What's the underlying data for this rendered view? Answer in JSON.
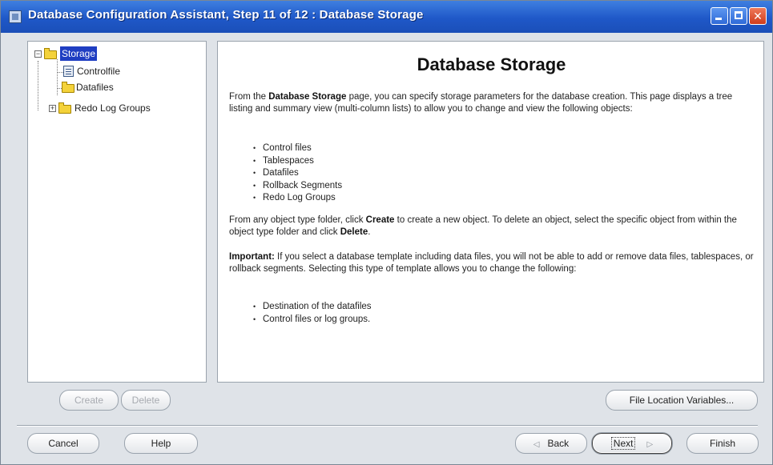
{
  "window": {
    "title": "Database Configuration Assistant, Step 11 of 12 : Database Storage"
  },
  "tree": {
    "root": {
      "label": "Storage",
      "expander": "−"
    },
    "items": [
      {
        "label": "Controlfile",
        "icon": "file-icon"
      },
      {
        "label": "Datafiles",
        "icon": "folder-icon"
      },
      {
        "label": "Redo Log Groups",
        "icon": "folder-icon",
        "expander": "+"
      }
    ]
  },
  "content": {
    "heading": "Database Storage",
    "intro": {
      "pre": "From the ",
      "bold": "Database Storage",
      "post": " page, you can specify storage parameters for the database creation. This page displays a tree listing and summary view (multi-column lists) to allow you to change and view the following objects:"
    },
    "objects": [
      "Control files",
      "Tablespaces",
      "Datafiles",
      "Rollback Segments",
      "Redo Log Groups"
    ],
    "create_para": {
      "p1": "From any object type folder, click ",
      "b1": "Create",
      "p2": " to create a new object. To delete an object, select the specific object from within the object type folder and click ",
      "b2": "Delete",
      "p3": "."
    },
    "important": {
      "bold": "Important:",
      "text": " If you select a database template including data files, you will not be able to add or remove data files, tablespaces, or rollback segments. Selecting this type of template allows you to change the following:"
    },
    "changeable": [
      "Destination of the datafiles",
      "Control files or log groups."
    ]
  },
  "buttons": {
    "create": "Create",
    "delete": "Delete",
    "file_location": "File Location Variables...",
    "cancel": "Cancel",
    "help": "Help",
    "back": "Back",
    "next": "Next",
    "finish": "Finish"
  }
}
